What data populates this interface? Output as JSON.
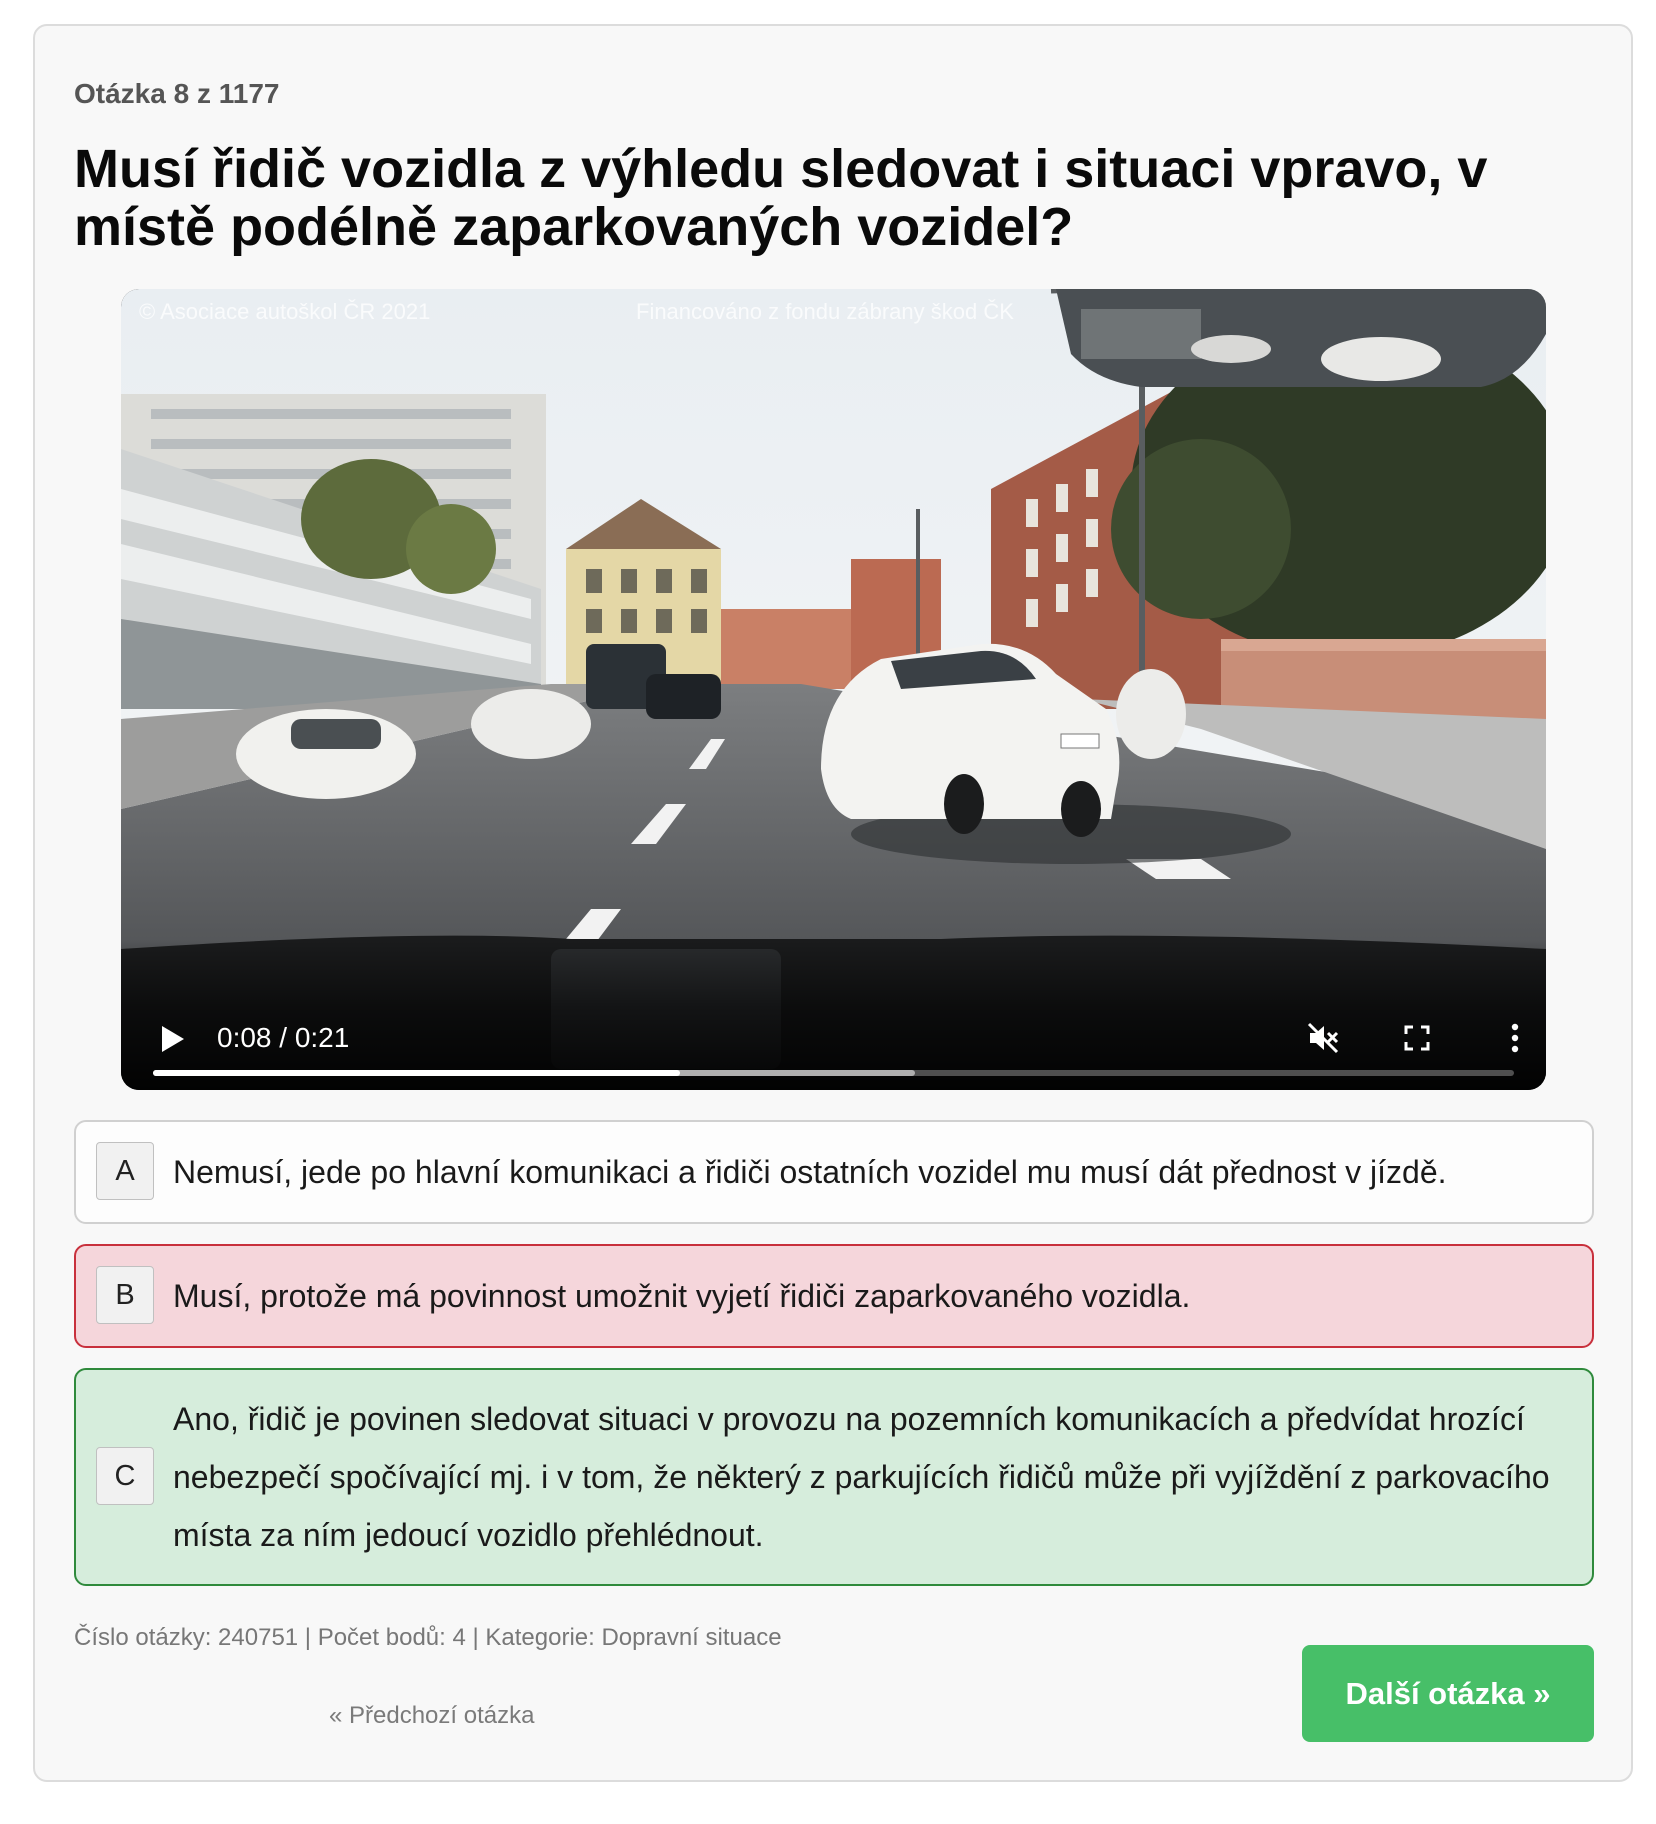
{
  "header": {
    "counter": "Otázka 8 z 1177",
    "question": "Musí řidič vozidla z výhledu sledovat i situaci vpravo, v místě podélně zaparkovaných vozidel?"
  },
  "video": {
    "watermark_left": "© Asociace autoškol ČR 2021",
    "watermark_center": "Financováno z fondu zábrany škod ČK",
    "time": "0:08 / 0:21",
    "progress_played": 0.387,
    "progress_buffered": 0.56,
    "muted": true,
    "icons": {
      "play": "play-icon",
      "mute": "volume-muted-icon",
      "fullscreen": "fullscreen-icon",
      "menu": "more-vertical-icon"
    }
  },
  "answers": [
    {
      "letter": "A",
      "text": "Nemusí, jede po hlavní komunikaci a řidiči ostatních vozidel mu musí dát přednost v jízdě.",
      "state": "neutral"
    },
    {
      "letter": "B",
      "text": "Musí, protože má povinnost umožnit vyjetí řidiči zaparkovaného vozidla.",
      "state": "wrong"
    },
    {
      "letter": "C",
      "text": "Ano, řidič je povinen sledovat situaci v provozu na pozemních komunikacích a předvídat hrozící nebezpečí spočívající mj. i v tom, že některý z parkujících řidičů může při vyjíždění z parkovacího místa za ním jedoucí vozidlo přehlédnout.",
      "state": "correct"
    }
  ],
  "footer": {
    "meta": "Číslo otázky: 240751 | Počet bodů: 4 | Kategorie: Dopravní situace",
    "prev_label": "« Předchozí otázka",
    "next_label": "Další otázka »"
  },
  "colors": {
    "wrong_bg": "#f5d6db",
    "wrong_border": "#c8303c",
    "correct_bg": "#d6eddc",
    "correct_border": "#2f8a3c",
    "next_button": "#47bf68"
  }
}
